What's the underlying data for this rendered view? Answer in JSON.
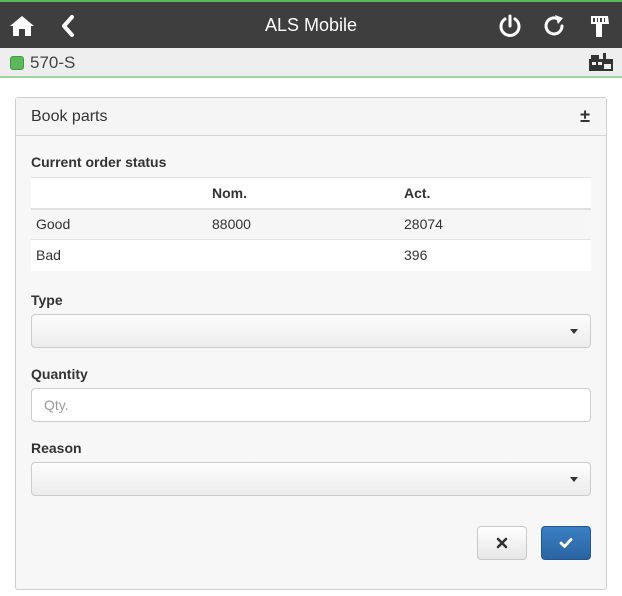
{
  "app": {
    "title": "ALS Mobile"
  },
  "status": {
    "workplace": "570-S",
    "led_color": "#5cb85c"
  },
  "panel": {
    "title": "Book parts",
    "toggle": "±",
    "order_status_label": "Current order status",
    "table": {
      "headers": [
        "",
        "Nom.",
        "Act."
      ],
      "rows": [
        [
          "Good",
          "88000",
          "28074"
        ],
        [
          "Bad",
          "",
          "396"
        ]
      ]
    },
    "type": {
      "label": "Type",
      "selected": ""
    },
    "quantity": {
      "label": "Quantity",
      "value": "",
      "placeholder": "Qty."
    },
    "reason": {
      "label": "Reason",
      "selected": ""
    }
  },
  "icons": {
    "home": "home-icon",
    "back": "chevron-left-icon",
    "power": "power-icon",
    "refresh": "refresh-icon",
    "scanner": "barcode-scanner-icon",
    "machine": "machine-icon",
    "cancel": "close-icon",
    "confirm": "check-icon"
  },
  "colors": {
    "header_bg": "#3e3e3e",
    "accent": "#5cb85c",
    "primary": "#2f6fb1"
  }
}
